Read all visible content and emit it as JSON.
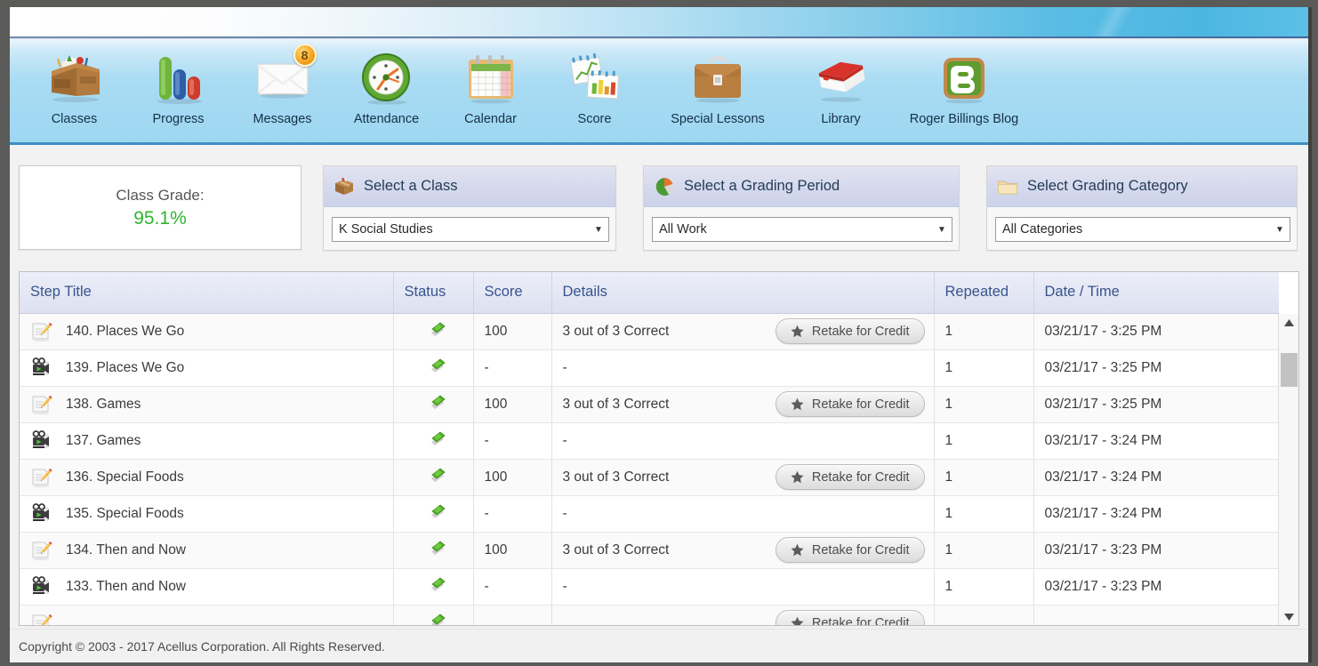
{
  "nav": {
    "items": [
      {
        "label": "Classes",
        "icon": "desk-icon",
        "badge": null
      },
      {
        "label": "Progress",
        "icon": "bar-chart-icon",
        "badge": null
      },
      {
        "label": "Messages",
        "icon": "envelope-icon",
        "badge": "8"
      },
      {
        "label": "Attendance",
        "icon": "clock-icon",
        "badge": null
      },
      {
        "label": "Calendar",
        "icon": "calendar-icon",
        "badge": null
      },
      {
        "label": "Score",
        "icon": "charts-icon",
        "badge": null
      },
      {
        "label": "Special Lessons",
        "icon": "briefcase-icon",
        "badge": null
      },
      {
        "label": "Library",
        "icon": "book-icon",
        "badge": null
      },
      {
        "label": "Roger Billings Blog",
        "icon": "blogger-b-icon",
        "badge": null
      }
    ]
  },
  "class_grade": {
    "label": "Class Grade:",
    "value": "95.1%",
    "value_color": "#2db42d"
  },
  "selectors": [
    {
      "title": "Select a Class",
      "icon": "box-icon",
      "selected": "K Social Studies",
      "arrow": "▼"
    },
    {
      "title": "Select a Grading Period",
      "icon": "pie-chart-icon",
      "selected": "All Work",
      "arrow": "▼"
    },
    {
      "title": "Select Grading Category",
      "icon": "folder-icon",
      "selected": "All Categories",
      "arrow": "▼"
    }
  ],
  "table": {
    "columns": [
      "Step Title",
      "Status",
      "Score",
      "Details",
      "Repeated",
      "Date / Time"
    ],
    "retake_label": "Retake for Credit",
    "rows": [
      {
        "icon": "quiz-paper-pencil-icon",
        "title": "140. Places We Go",
        "status": "green-diamond-icon",
        "score": "100",
        "details": "3 out of 3 Correct",
        "retake": true,
        "repeated": "1",
        "datetime": "03/21/17 - 3:25 PM"
      },
      {
        "icon": "video-camera-icon",
        "title": "139. Places We Go",
        "status": "green-diamond-icon",
        "score": "-",
        "details": "-",
        "retake": false,
        "repeated": "1",
        "datetime": "03/21/17 - 3:25 PM"
      },
      {
        "icon": "quiz-paper-pencil-icon",
        "title": "138. Games",
        "status": "green-diamond-icon",
        "score": "100",
        "details": "3 out of 3 Correct",
        "retake": true,
        "repeated": "1",
        "datetime": "03/21/17 - 3:25 PM"
      },
      {
        "icon": "video-camera-icon",
        "title": "137. Games",
        "status": "green-diamond-icon",
        "score": "-",
        "details": "-",
        "retake": false,
        "repeated": "1",
        "datetime": "03/21/17 - 3:24 PM"
      },
      {
        "icon": "quiz-paper-pencil-icon",
        "title": "136. Special Foods",
        "status": "green-diamond-icon",
        "score": "100",
        "details": "3 out of 3 Correct",
        "retake": true,
        "repeated": "1",
        "datetime": "03/21/17 - 3:24 PM"
      },
      {
        "icon": "video-camera-icon",
        "title": "135. Special Foods",
        "status": "green-diamond-icon",
        "score": "-",
        "details": "-",
        "retake": false,
        "repeated": "1",
        "datetime": "03/21/17 - 3:24 PM"
      },
      {
        "icon": "quiz-paper-pencil-icon",
        "title": "134. Then and Now",
        "status": "green-diamond-icon",
        "score": "100",
        "details": "3 out of 3 Correct",
        "retake": true,
        "repeated": "1",
        "datetime": "03/21/17 - 3:23 PM"
      },
      {
        "icon": "video-camera-icon",
        "title": "133. Then and Now",
        "status": "green-diamond-icon",
        "score": "-",
        "details": "-",
        "retake": false,
        "repeated": "1",
        "datetime": "03/21/17 - 3:23 PM"
      },
      {
        "icon": "quiz-paper-pencil-icon",
        "title": "",
        "status": "green-diamond-icon",
        "score": "",
        "details": "",
        "retake": true,
        "repeated": "",
        "datetime": ""
      }
    ]
  },
  "scrollbar": {
    "up_arrow": "▲",
    "down_arrow": "▼"
  },
  "footer": {
    "text": "Copyright © 2003 - 2017 Acellus Corporation.  All Rights Reserved."
  }
}
